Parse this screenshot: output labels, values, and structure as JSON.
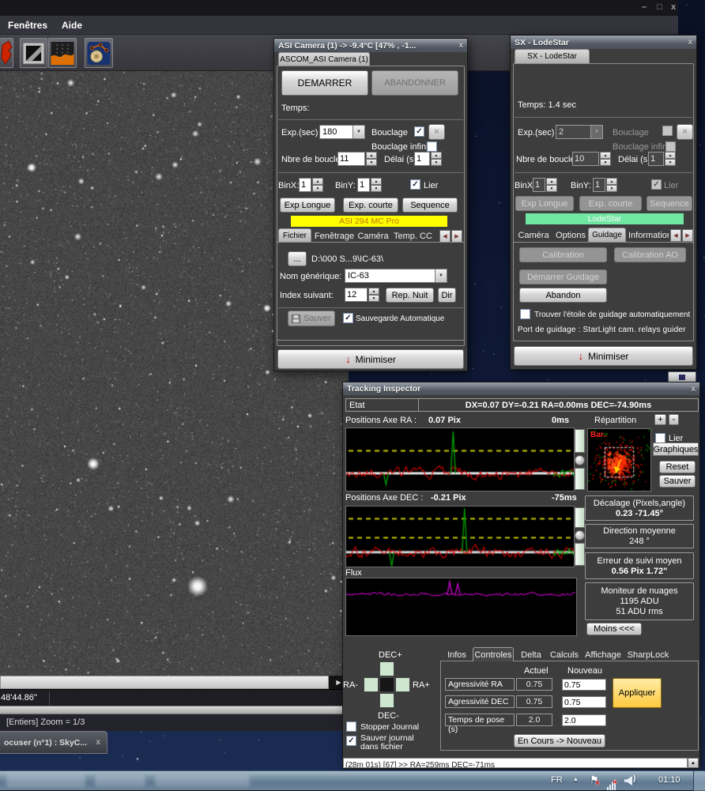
{
  "icons": {
    "up": "▲",
    "down": "▼",
    "left": "◀",
    "right": "▶",
    "dropdown": "▼",
    "check": "✓",
    "red_arrow": "↓",
    "scroll_right": "▶",
    "scroll_up": "▲",
    "tray_expand": "▲",
    "flag": "⚑",
    "cross": "×",
    "plus": "+",
    "minus": "-"
  },
  "window_controls": {
    "minimize": "–",
    "maximize": "□",
    "close": "x"
  },
  "menu_bar": {
    "items": [
      "Fenêtres",
      "Aide"
    ]
  },
  "asi_window": {
    "title": "ASI Camera (1)  ->  -9.4°C  [47% , -1...",
    "tab": "ASCOM_ASI Camera (1)",
    "demarrer": "DEMARRER",
    "abandonner": "ABANDONNER",
    "temps": "Temps:",
    "exp_label": "Exp.(sec)",
    "exp_value": "180",
    "bouclage": "Bouclage",
    "bouclage_infini": "Bouclage infini",
    "nbre_label": "Nbre de boucles",
    "nbre_value": "11",
    "delai_label": "Délai (s)",
    "delai_value": "1",
    "binx_label": "BinX:",
    "binx_value": "1",
    "biny_label": "BinY:",
    "biny_value": "1",
    "lier": "Lier",
    "exp_longue": "Exp Longue",
    "exp_courte": "Exp. courte",
    "sequence": "Sequence",
    "camera_banner": "ASI 294 MC Pro",
    "file_tabs": [
      "Fichier",
      "Fenêtrage",
      "Caméra",
      "Temp. CC"
    ],
    "browse": "...",
    "path": "D:\\000 S...9\\IC-63\\",
    "nom_label": "Nom générique:",
    "nom_value": "IC-63",
    "index_label": "Index suivant:",
    "index_value": "12",
    "rep_nuit": "Rep. Nuit",
    "dir": "Dir",
    "sauver": "Sauver",
    "sauvegarde_auto": "Sauvegarde Automatique",
    "minimiser": "Minimiser"
  },
  "sx_window": {
    "title": "SX - LodeStar",
    "tab": "SX - LodeStar",
    "temps": "Temps: 1.4 sec",
    "exp_label": "Exp.(sec)",
    "exp_value": "2",
    "bouclage": "Bouclage",
    "bouclage_infini": "Bouclage infini",
    "nbre_label": "Nbre de boucles",
    "nbre_value": "10",
    "delai_label": "Délai (s)",
    "delai_value": "1",
    "binx_label": "BinX:",
    "binx_value": "1",
    "biny_label": "BinY:",
    "biny_value": "1",
    "lier": "Lier",
    "exp_longue": "Exp Longue",
    "exp_courte": "Exp. courte",
    "sequence": "Sequence",
    "camera_banner": "LodeStar",
    "guide_tabs": [
      "Caméra",
      "Options",
      "Guidage",
      "Information"
    ],
    "calibration": "Calibration",
    "calibration_ao": "Calibration AO",
    "demarrer_guidage": "Démarrer Guidage",
    "abandon": "Abandon",
    "trouver": "Trouver l'étoile de guidage automatiquement",
    "port": "Port de guidage : StarLight cam. relays guider",
    "minimiser": "Minimiser"
  },
  "tracking_window": {
    "title": "Tracking Inspector",
    "etat_label": "Etat",
    "etat_value": "DX=0.07  DY=-0.21  RA=0.00ms  DEC=-74.90ms",
    "ra_label": "Positions Axe RA :",
    "ra_pix": "0.07 Pix",
    "ra_ms": "0ms",
    "repartition": "Répartition",
    "bar_label": "Bar.",
    "lier": "Lier",
    "graphiques": "Graphiques",
    "reset": "Reset",
    "sauver": "Sauver",
    "dec_label": "Positions Axe DEC :",
    "dec_pix": "-0.21 Pix",
    "dec_ms": "-75ms",
    "flux_label": "Flux",
    "decalage_title": "Décalage (Pixels,angle)",
    "decalage_value": "0.23  -71.45°",
    "direction_title": "Direction moyenne",
    "direction_value": "248 °",
    "erreur_title": "Erreur de suivi moyen",
    "erreur_value": "0.56 Pix  1.72\"",
    "nuages_title": "Moniteur de nuages",
    "nuages_adu": "1195 ADU",
    "nuages_rms": "51 ADU rms",
    "moins": "Moins <<<",
    "pad": {
      "up": "DEC+",
      "left": "RA-",
      "right": "RA+",
      "down": "DEC-"
    },
    "tabs": [
      "Infos",
      "Controles",
      "Delta",
      "Calculs",
      "Affichage",
      "SharpLock"
    ],
    "col_actuel": "Actuel",
    "col_nouveau": "Nouveau",
    "rows": [
      {
        "label": "Agressivité RA",
        "actuel": "0.75",
        "nouveau": "0.75"
      },
      {
        "label": "Agressivité DEC",
        "actuel": "0.75",
        "nouveau": "0.75"
      },
      {
        "label": "Temps de pose (s)",
        "actuel": "2.0",
        "nouveau": "2.0"
      }
    ],
    "appliquer": "Appliquer",
    "en_cours": "En Cours -> Nouveau",
    "stopper_journal": "Stopper Journal",
    "sauver_journal_1": "Sauver journal",
    "sauver_journal_2": "dans fichier",
    "log": "(28m 01s) [67] >> RA=259ms  DEC=-71ms"
  },
  "starfield_window": {
    "coord_status": "48'44.86''",
    "zoom_status": "[Entiers]  Zoom = 1/3",
    "bottom_tab": "ocuser (n°1) : SkyC..."
  },
  "taskbar": {
    "language": "FR",
    "time": "01:10"
  }
}
